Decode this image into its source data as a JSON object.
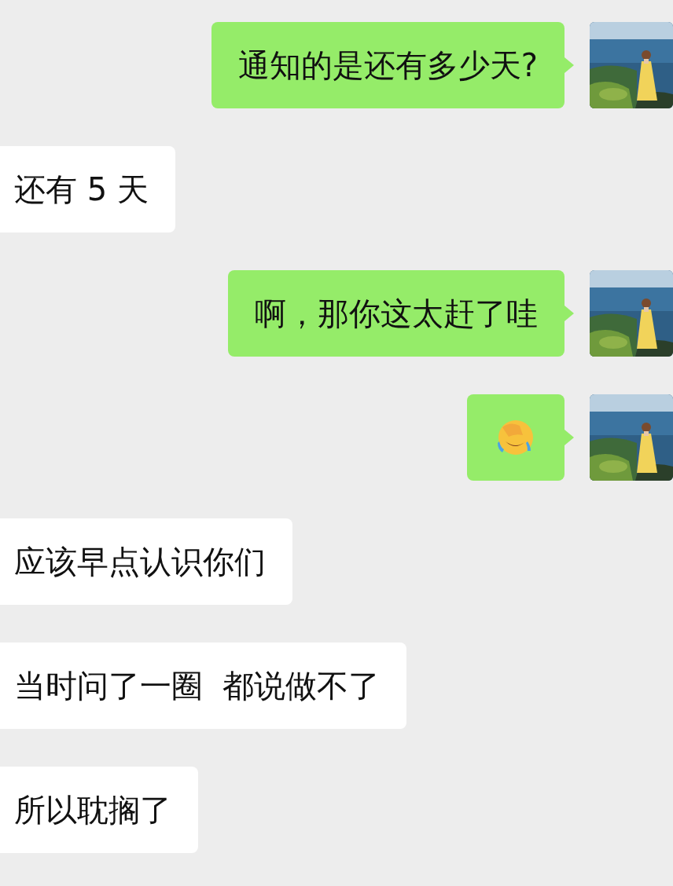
{
  "messages": [
    {
      "outgoing": true,
      "kind": "text",
      "text": "通知的是还有多少天?"
    },
    {
      "outgoing": false,
      "kind": "text",
      "text": "还有 5 天"
    },
    {
      "outgoing": true,
      "kind": "text",
      "text": "啊，那你这太赶了哇"
    },
    {
      "outgoing": true,
      "kind": "emoji"
    },
    {
      "outgoing": false,
      "kind": "text",
      "text": "应该早点认识你们"
    },
    {
      "outgoing": false,
      "kind": "text",
      "text": "当时问了一圈  都说做不了"
    },
    {
      "outgoing": false,
      "kind": "text",
      "text": "所以耽搁了"
    }
  ]
}
